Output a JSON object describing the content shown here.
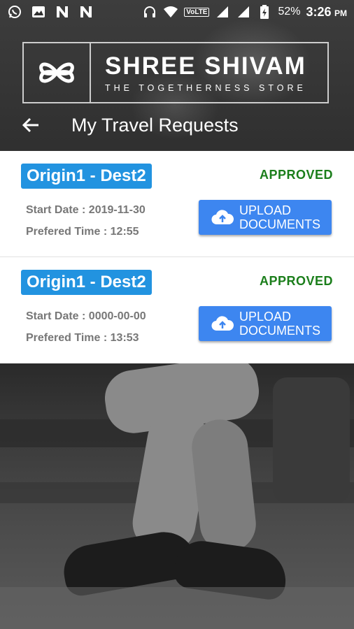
{
  "status_bar": {
    "battery_percent": "52%",
    "time": "3:26",
    "ampm": "PM",
    "volte_label": "VoLTE",
    "left_icons": [
      "whatsapp-icon",
      "gallery-icon",
      "notification-n-icon",
      "notification-n-icon"
    ],
    "right_icons": [
      "headphones-icon",
      "wifi-icon",
      "volte-icon",
      "signal-icon",
      "signal-icon",
      "battery-icon"
    ]
  },
  "brand": {
    "title": "SHREE SHIVAM",
    "tagline": "THE TOGETHERNESS STORE"
  },
  "appbar": {
    "title": "My Travel Requests"
  },
  "requests": [
    {
      "route": "Origin1 - Dest2",
      "status": "APPROVED",
      "start_label": "Start Date : ",
      "start_value": "2019-11-30",
      "time_label": "Prefered Time : ",
      "time_value": "12:55",
      "upload_line1": "UPLOAD",
      "upload_line2": "DOCUMENTS"
    },
    {
      "route": "Origin1 - Dest2",
      "status": "APPROVED",
      "start_label": "Start Date : ",
      "start_value": "0000-00-00",
      "time_label": "Prefered Time : ",
      "time_value": "13:53",
      "upload_line1": "UPLOAD",
      "upload_line2": "DOCUMENTS"
    }
  ],
  "colors": {
    "route_badge": "#2293e0",
    "status_approved": "#1b7e1b",
    "upload_button": "#3d86f0"
  }
}
